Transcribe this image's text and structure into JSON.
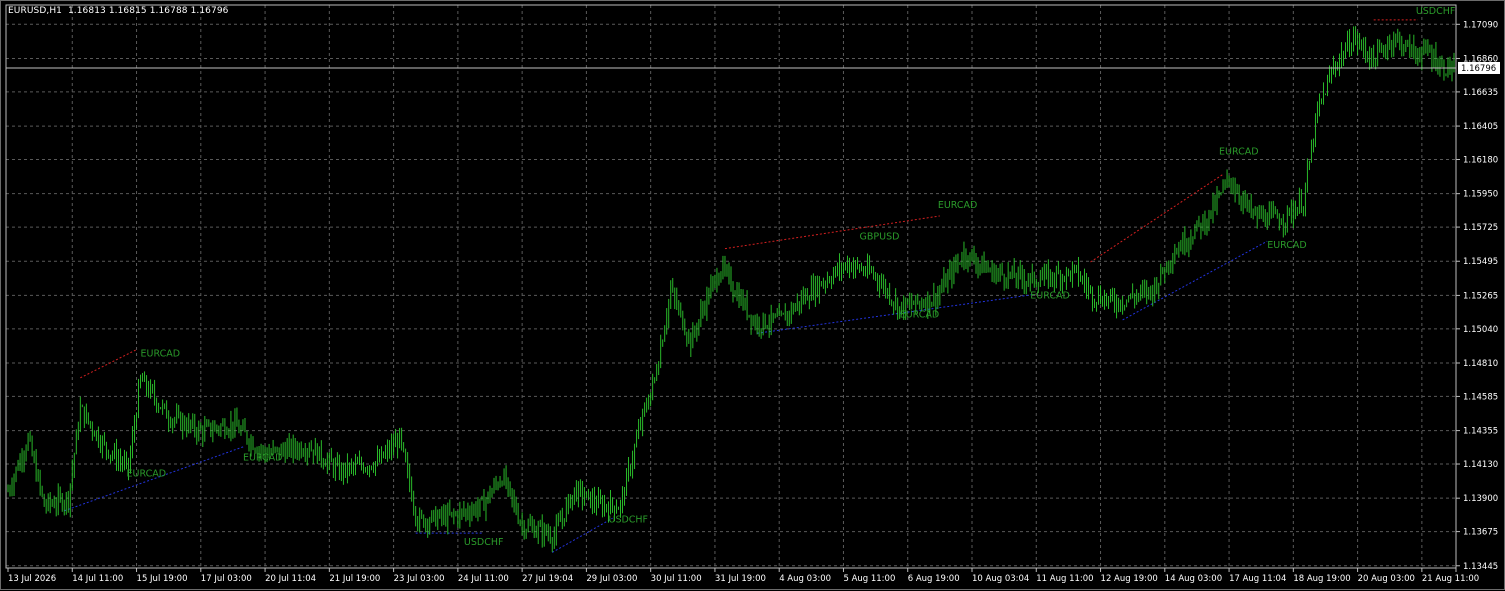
{
  "header": {
    "symbol": "EURUSD,H1",
    "ohlc": "1.16813 1.16815 1.16788 1.16796"
  },
  "colors": {
    "background": "#000000",
    "grid": "#5a5a5a",
    "bars": "#2ecc2e",
    "axis_text": "#ffffff",
    "resistance_line": "#d42020",
    "support_line": "#2233dd",
    "annotation": "#2a9a2a",
    "price_line": "#c0c0c0"
  },
  "chart_data": {
    "type": "ohlc",
    "symbol": "EURUSD",
    "timeframe": "H1",
    "current_price": "1.16796",
    "y_ticks": [
      "1.17090",
      "1.16860",
      "1.16635",
      "1.16405",
      "1.16180",
      "1.15950",
      "1.15725",
      "1.15495",
      "1.15265",
      "1.15040",
      "1.14810",
      "1.14585",
      "1.14355",
      "1.14130",
      "1.13900",
      "1.13675",
      "1.13445"
    ],
    "ylim": [
      1.1343,
      1.1722
    ],
    "x_ticks": [
      "13 Jul 2026",
      "14 Jul 11:00",
      "15 Jul 19:00",
      "17 Jul 03:00",
      "20 Jul 11:04",
      "21 Jul 19:00",
      "23 Jul 03:00",
      "24 Jul 11:00",
      "27 Jul 19:04",
      "29 Jul 03:00",
      "30 Jul 11:00",
      "31 Jul 19:00",
      "4 Aug 03:00",
      "5 Aug 11:00",
      "6 Aug 19:00",
      "10 Aug 03:04",
      "11 Aug 11:00",
      "12 Aug 19:00",
      "14 Aug 03:00",
      "17 Aug 11:04",
      "18 Aug 19:00",
      "20 Aug 03:00",
      "21 Aug 11:00"
    ],
    "x_tick_index": [
      0,
      32,
      64,
      96,
      128,
      160,
      192,
      224,
      256,
      288,
      320,
      352,
      384,
      416,
      448,
      480,
      512,
      544,
      576,
      608,
      640,
      672,
      704
    ],
    "bar_count": 721,
    "price_path": [
      [
        0,
        1.1395
      ],
      [
        10,
        1.143
      ],
      [
        18,
        1.1385
      ],
      [
        30,
        1.139
      ],
      [
        36,
        1.145
      ],
      [
        48,
        1.1425
      ],
      [
        60,
        1.141
      ],
      [
        66,
        1.147
      ],
      [
        80,
        1.1445
      ],
      [
        96,
        1.1435
      ],
      [
        112,
        1.144
      ],
      [
        128,
        1.142
      ],
      [
        150,
        1.1425
      ],
      [
        165,
        1.1408
      ],
      [
        185,
        1.1415
      ],
      [
        195,
        1.143
      ],
      [
        204,
        1.1375
      ],
      [
        222,
        1.1378
      ],
      [
        236,
        1.1385
      ],
      [
        246,
        1.1405
      ],
      [
        256,
        1.1372
      ],
      [
        272,
        1.1365
      ],
      [
        282,
        1.1395
      ],
      [
        295,
        1.1385
      ],
      [
        305,
        1.1385
      ],
      [
        315,
        1.144
      ],
      [
        322,
        1.147
      ],
      [
        330,
        1.153
      ],
      [
        340,
        1.1495
      ],
      [
        348,
        1.1525
      ],
      [
        355,
        1.1545
      ],
      [
        362,
        1.153
      ],
      [
        372,
        1.1508
      ],
      [
        385,
        1.151
      ],
      [
        400,
        1.153
      ],
      [
        418,
        1.1548
      ],
      [
        432,
        1.154
      ],
      [
        444,
        1.1518
      ],
      [
        462,
        1.1525
      ],
      [
        476,
        1.1555
      ],
      [
        490,
        1.1542
      ],
      [
        510,
        1.1537
      ],
      [
        532,
        1.1542
      ],
      [
        540,
        1.1527
      ],
      [
        552,
        1.1522
      ],
      [
        570,
        1.153
      ],
      [
        580,
        1.1555
      ],
      [
        598,
        1.158
      ],
      [
        608,
        1.1605
      ],
      [
        620,
        1.158
      ],
      [
        635,
        1.1578
      ],
      [
        645,
        1.159
      ],
      [
        652,
        1.165
      ],
      [
        660,
        1.168
      ],
      [
        670,
        1.17
      ],
      [
        680,
        1.1685
      ],
      [
        690,
        1.17
      ],
      [
        700,
        1.169
      ],
      [
        708,
        1.169
      ],
      [
        714,
        1.168
      ],
      [
        720,
        1.168
      ]
    ],
    "annotations": [
      {
        "text": "EURCAD",
        "i": 66,
        "p": 1.14855,
        "color": "#2a9a2a"
      },
      {
        "text": "EURCAD",
        "i": 59,
        "p": 1.14045,
        "color": "#2a9a2a"
      },
      {
        "text": "EURCAD",
        "i": 117,
        "p": 1.14155,
        "color": "#2a9a2a"
      },
      {
        "text": "USDCHF",
        "i": 227,
        "p": 1.13585,
        "color": "#2a9a2a"
      },
      {
        "text": "USDCHF",
        "i": 299,
        "p": 1.13735,
        "color": "#2a9a2a"
      },
      {
        "text": "GBPUSD",
        "i": 424,
        "p": 1.1564,
        "color": "#2a9a2a"
      },
      {
        "text": "EURCAD",
        "i": 463,
        "p": 1.15855,
        "color": "#2a9a2a"
      },
      {
        "text": "EURCAD",
        "i": 444,
        "p": 1.15115,
        "color": "#2a9a2a"
      },
      {
        "text": "EURCAD",
        "i": 509,
        "p": 1.15245,
        "color": "#2a9a2a"
      },
      {
        "text": "EURCAD",
        "i": 603,
        "p": 1.16215,
        "color": "#2a9a2a"
      },
      {
        "text": "EURCAD",
        "i": 627,
        "p": 1.15585,
        "color": "#2a9a2a"
      },
      {
        "text": "USDCHF",
        "i": 701,
        "p": 1.1716,
        "color": "#2a9a2a"
      }
    ],
    "trend_lines": [
      {
        "type": "resistance",
        "from": [
          36,
          1.1471
        ],
        "to": [
          64,
          1.149
        ]
      },
      {
        "type": "resistance",
        "from": [
          357,
          1.1558
        ],
        "to": [
          464,
          1.158
        ]
      },
      {
        "type": "resistance",
        "from": [
          539,
          1.1549
        ],
        "to": [
          605,
          1.1608
        ]
      },
      {
        "type": "resistance",
        "from": [
          680,
          1.1712
        ],
        "to": [
          702,
          1.1712
        ]
      },
      {
        "type": "support",
        "from": [
          28,
          1.13815
        ],
        "to": [
          118,
          1.1425
        ]
      },
      {
        "type": "support",
        "from": [
          203,
          1.13665
        ],
        "to": [
          236,
          1.13665
        ]
      },
      {
        "type": "support",
        "from": [
          271,
          1.13535
        ],
        "to": [
          301,
          1.13765
        ]
      },
      {
        "type": "support",
        "from": [
          373,
          1.1501
        ],
        "to": [
          510,
          1.1527
        ]
      },
      {
        "type": "support",
        "from": [
          555,
          1.151
        ],
        "to": [
          627,
          1.1563
        ]
      }
    ]
  }
}
